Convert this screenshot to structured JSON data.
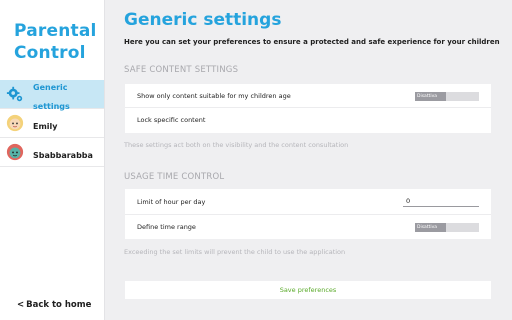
{
  "sidebar": {
    "title": "Parental Control",
    "items": [
      {
        "label": "Generic settings",
        "icon": "gears-icon",
        "active": true
      },
      {
        "label": "Emily",
        "icon": "child-avatar-icon",
        "active": false
      },
      {
        "label": "Sbabbarabba",
        "icon": "child-avatar-icon",
        "active": false
      }
    ],
    "back_label": "Back to home",
    "back_glyph": "<"
  },
  "main": {
    "title": "Generic settings",
    "subtitle": "Here you can set your preferences to ensure a protected and safe experience for your children",
    "safe_content": {
      "header": "SAFE CONTENT SETTINGS",
      "rows": [
        {
          "label": "Show only content suitable for my children age",
          "toggle": "Disattiva"
        },
        {
          "label": "Lock specific content"
        }
      ],
      "note": "These settings act both on the visibility and the content consultation"
    },
    "usage_time": {
      "header": "USAGE TIME CONTROL",
      "rows": [
        {
          "label": "Limit of hour per day",
          "value": "0"
        },
        {
          "label": "Define time range",
          "toggle": "Disattiva"
        }
      ],
      "note": "Exceeding the set limits will prevent the child to use the application"
    },
    "save_label": "Save preferences"
  },
  "colors": {
    "accent": "#25a3dd",
    "active_bg": "#c7e7f5",
    "save_text": "#5aaa2a"
  }
}
